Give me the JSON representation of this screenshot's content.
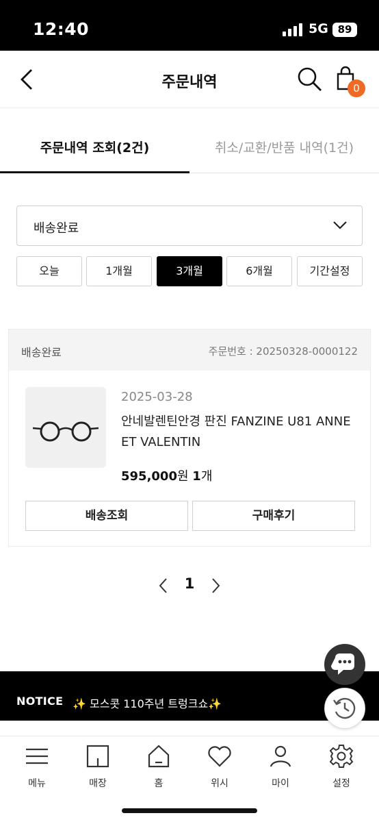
{
  "status_bar": {
    "time": "12:40",
    "network": "5G",
    "battery": "89"
  },
  "header": {
    "title": "주문내역",
    "cart_count": "0"
  },
  "tabs": [
    {
      "label": "주문내역 조회(2건)",
      "active": true
    },
    {
      "label": "취소/교환/반품 내역(1건)",
      "active": false
    }
  ],
  "filter": {
    "selected_status": "배송완료",
    "periods": [
      "오늘",
      "1개월",
      "3개월",
      "6개월",
      "기간설정"
    ],
    "active_period": "3개월"
  },
  "order": {
    "status": "배송완료",
    "order_number": "주문번호 : 20250328-0000122",
    "date": "2025-03-28",
    "product_name": "안네발렌틴안경 판진 FANZINE U81 ANNE ET VALENTIN",
    "price": "595,000",
    "price_unit": "원",
    "quantity": "1",
    "quantity_unit": "개",
    "buttons": {
      "track": "배송조회",
      "review": "구매후기"
    }
  },
  "pagination": {
    "current": "1"
  },
  "notice": {
    "label": "NOTICE",
    "text": "✨ 모스콧 110주년 트렁크쇼✨"
  },
  "bottom_nav": [
    {
      "label": "메뉴",
      "icon": "menu-icon"
    },
    {
      "label": "매장",
      "icon": "store-icon"
    },
    {
      "label": "홈",
      "icon": "home-icon"
    },
    {
      "label": "위시",
      "icon": "heart-icon"
    },
    {
      "label": "마이",
      "icon": "user-icon"
    },
    {
      "label": "설정",
      "icon": "gear-icon"
    }
  ],
  "colors": {
    "accent": "#ef6a24",
    "dark": "#000000",
    "muted": "#9a9a9a"
  }
}
